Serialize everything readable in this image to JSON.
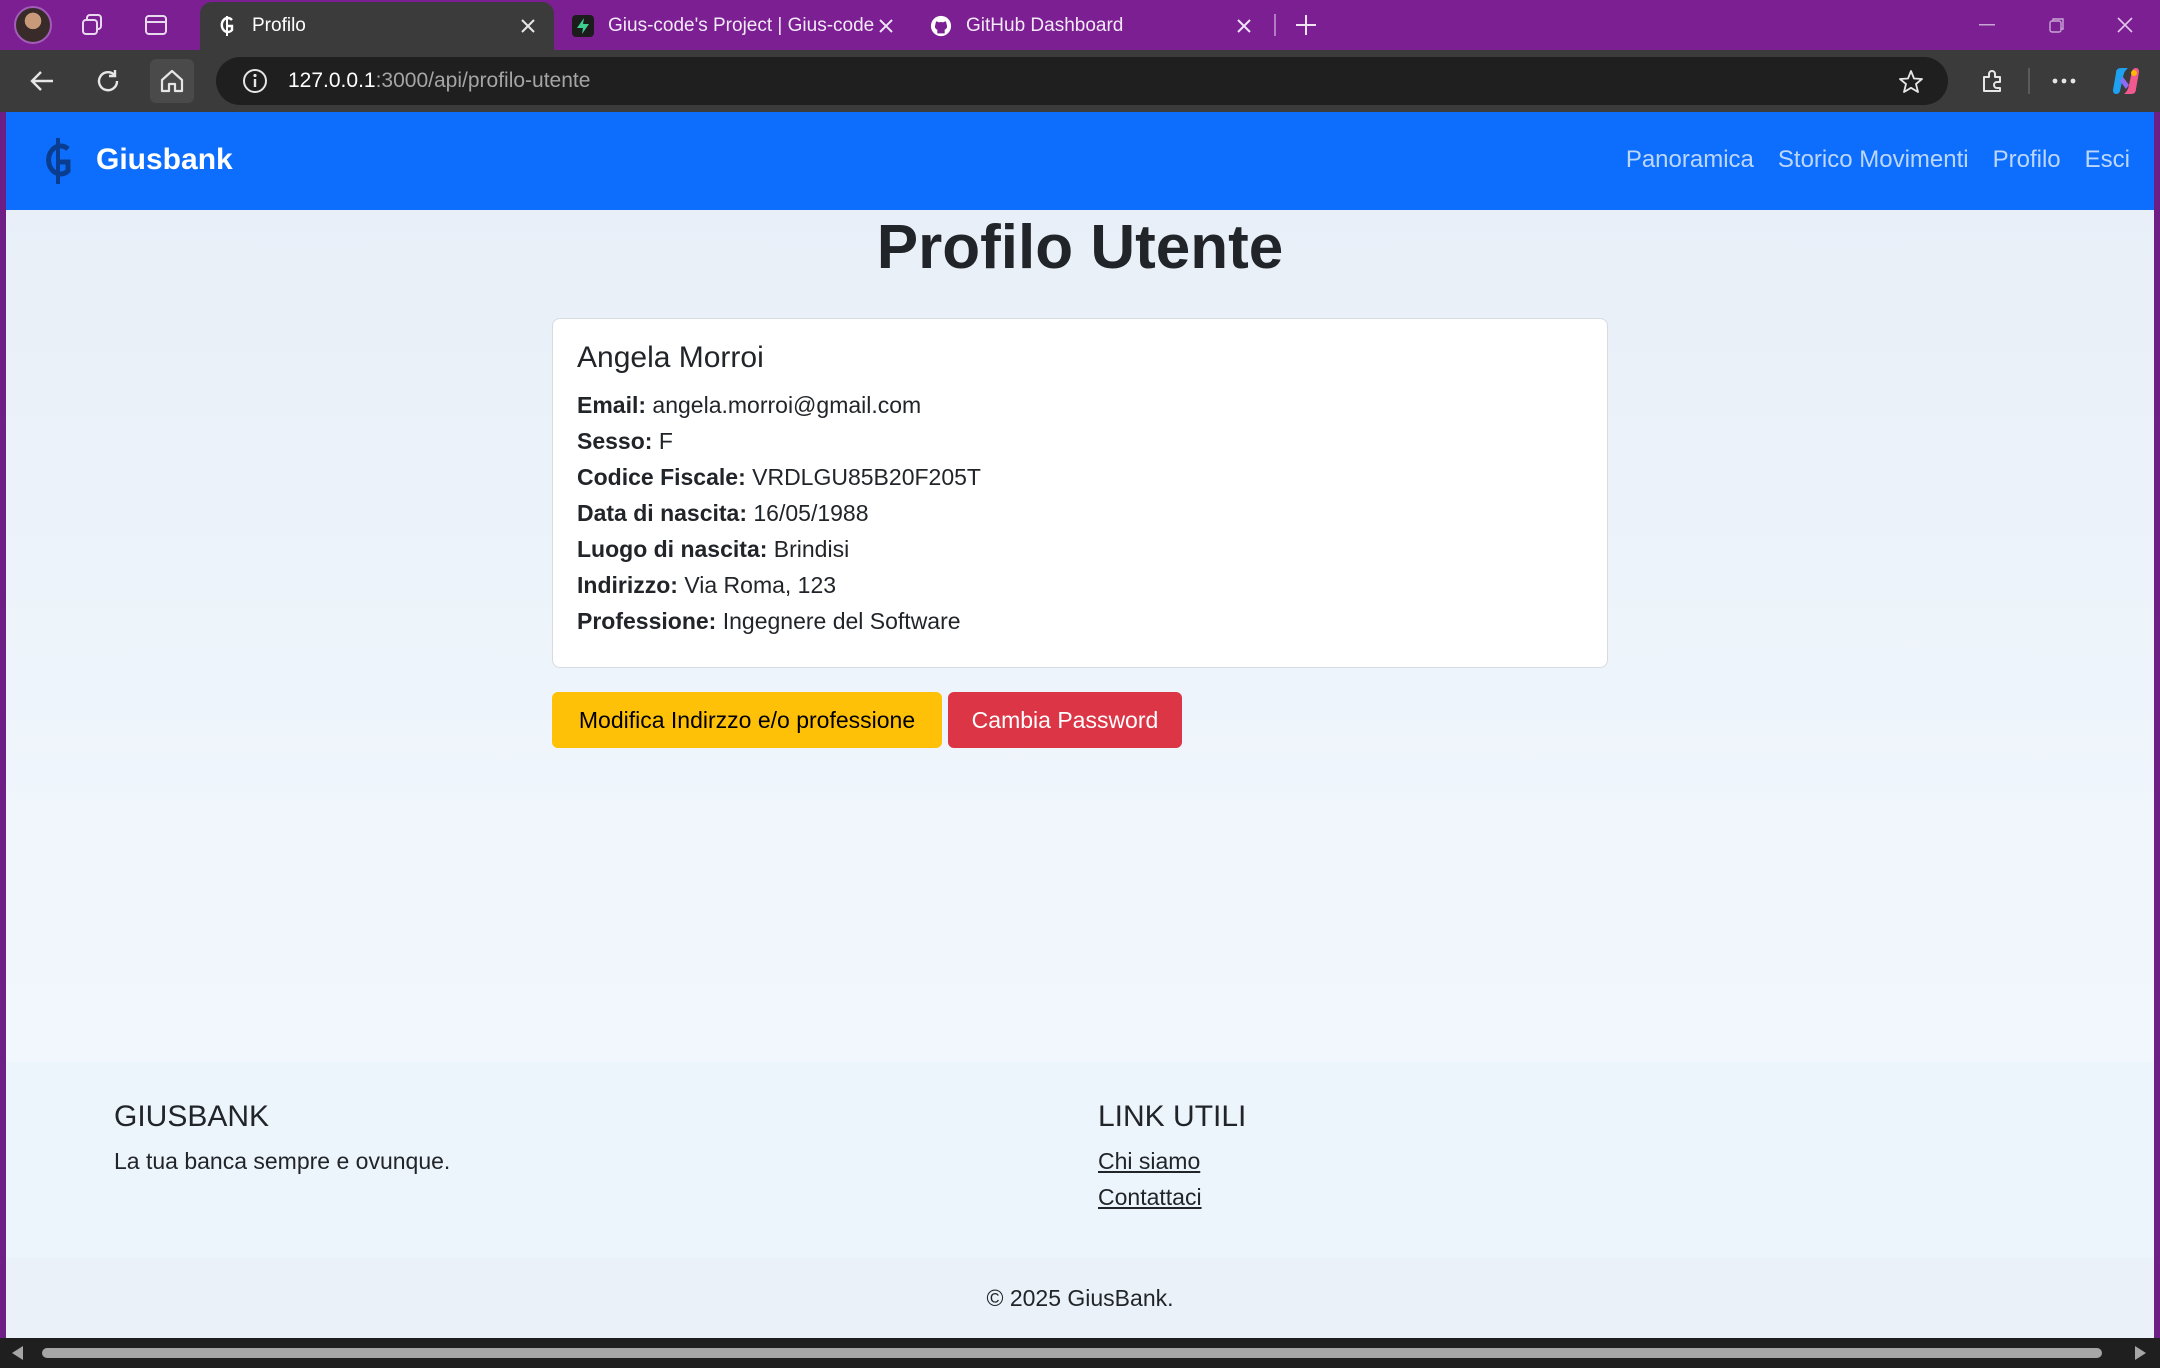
{
  "browser": {
    "tabs": [
      {
        "title": "Profilo",
        "active": true,
        "favicon": "giusbank-icon"
      },
      {
        "title": "Gius-code's Project | Gius-code's",
        "active": false,
        "favicon": "supabase-icon"
      },
      {
        "title": "GitHub Dashboard",
        "active": false,
        "favicon": "github-icon"
      }
    ],
    "url_host": "127.0.0.1",
    "url_rest": ":3000/api/profilo-utente"
  },
  "navbar": {
    "brand": "Giusbank",
    "links": [
      "Panoramica",
      "Storico Movimenti",
      "Profilo",
      "Esci"
    ]
  },
  "page": {
    "title": "Profilo Utente"
  },
  "profile": {
    "name": "Angela Morroi",
    "fields": [
      {
        "label": "Email:",
        "value": "angela.morroi@gmail.com"
      },
      {
        "label": "Sesso:",
        "value": "F"
      },
      {
        "label": "Codice Fiscale:",
        "value": "VRDLGU85B20F205T"
      },
      {
        "label": "Data di nascita:",
        "value": "16/05/1988"
      },
      {
        "label": "Luogo di nascita:",
        "value": "Brindisi"
      },
      {
        "label": "Indirizzo:",
        "value": "Via Roma, 123"
      },
      {
        "label": "Professione:",
        "value": "Ingegnere del Software"
      }
    ]
  },
  "actions": {
    "edit_label": "Modifica Indirzzo e/o professione",
    "password_label": "Cambia Password"
  },
  "footer": {
    "brand_heading": "GIUSBANK",
    "tagline": "La tua banca sempre e ovunque.",
    "links_heading": "LINK UTILI",
    "links": [
      "Chi siamo",
      "Contattaci"
    ],
    "copyright": "© 2025 GiusBank."
  },
  "colors": {
    "tab_strip": "#7b1f93",
    "navbar": "#0d6efd",
    "warning_button": "#ffc107",
    "danger_button": "#dc3545"
  }
}
